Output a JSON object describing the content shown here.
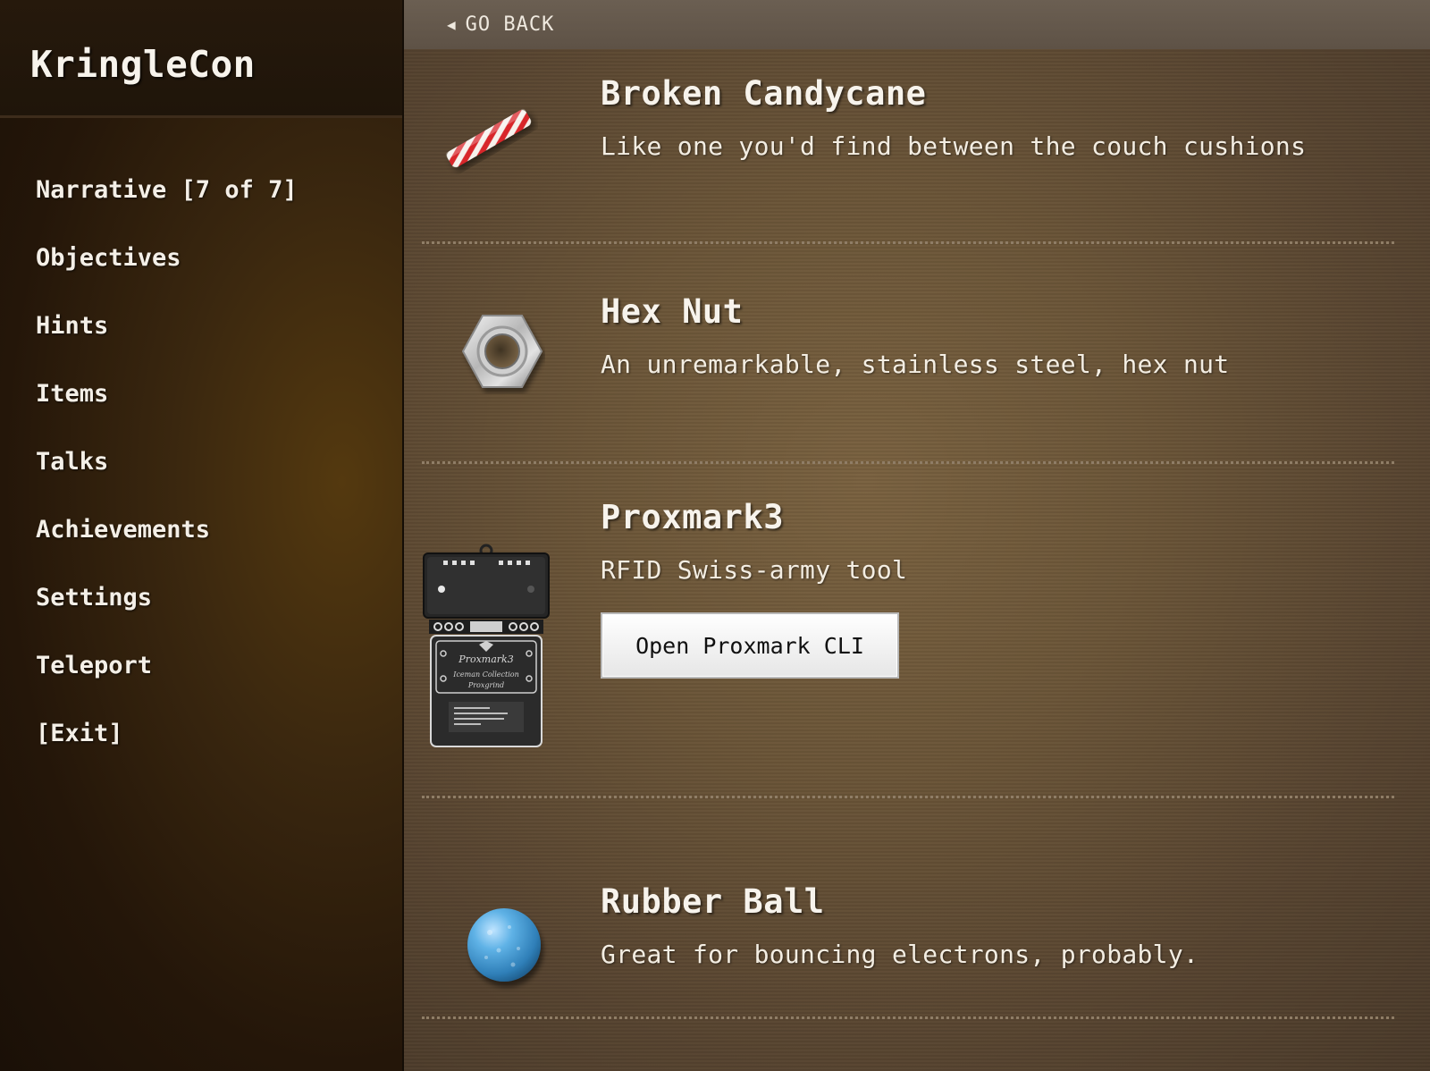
{
  "sidebar": {
    "brand": "KringleCon",
    "items": [
      {
        "label": "Narrative [7 of 7]"
      },
      {
        "label": "Objectives"
      },
      {
        "label": "Hints"
      },
      {
        "label": "Items"
      },
      {
        "label": "Talks"
      },
      {
        "label": "Achievements"
      },
      {
        "label": "Settings"
      },
      {
        "label": "Teleport"
      },
      {
        "label": "[Exit]"
      }
    ]
  },
  "topbar": {
    "back_label": "GO BACK",
    "back_icon": "triangle-left-icon"
  },
  "items": [
    {
      "name": "Broken Candycane",
      "description": "Like one you'd find between the couch cushions",
      "icon": "candycane-icon"
    },
    {
      "name": "Hex Nut",
      "description": "An unremarkable, stainless steel, hex nut",
      "icon": "hex-nut-icon"
    },
    {
      "name": "Proxmark3",
      "description": "RFID Swiss-army tool",
      "icon": "proxmark-device-icon",
      "button_label": "Open Proxmark CLI",
      "device_label": "Proxmark3",
      "device_sublabel": "Iceman Collection",
      "device_sublabel2": "Proxgrind"
    },
    {
      "name": "Rubber Ball",
      "description": "Great for bouncing electrons, probably.",
      "icon": "rubber-ball-icon"
    }
  ],
  "colors": {
    "sidebar_bg": "#2a1b0b",
    "main_bg": "#6b5538",
    "topbar_bg": "#655a4d",
    "text": "#f7f3ec",
    "divider": "#8f7d66"
  }
}
